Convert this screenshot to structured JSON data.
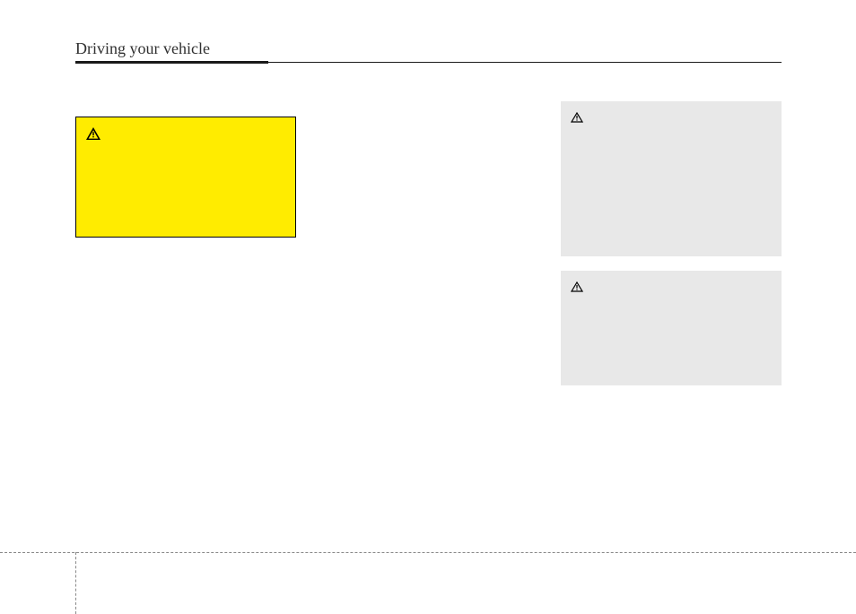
{
  "header": {
    "title": "Driving your vehicle"
  }
}
